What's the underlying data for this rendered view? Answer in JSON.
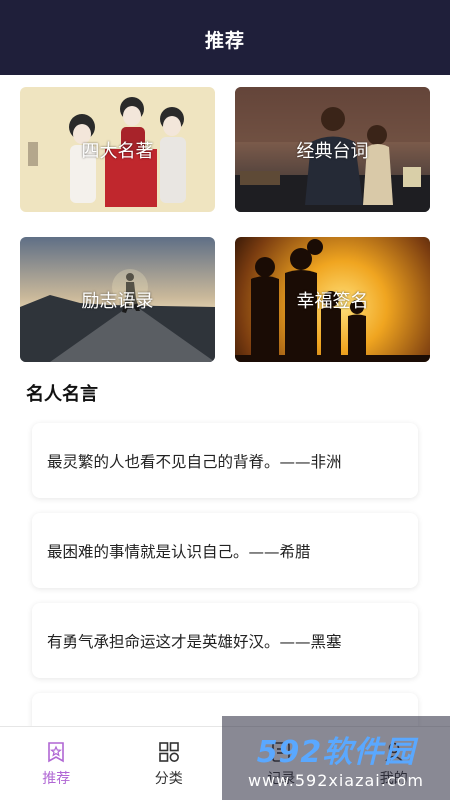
{
  "header": {
    "title": "推荐"
  },
  "categories": [
    {
      "label": "四大名著"
    },
    {
      "label": "经典台词"
    },
    {
      "label": "励志语录"
    },
    {
      "label": "幸福签名"
    }
  ],
  "section": {
    "title": "名人名言"
  },
  "quotes": [
    {
      "text": "最灵繁的人也看不见自己的背脊。——非洲"
    },
    {
      "text": "最困难的事情就是认识自己。——希腊"
    },
    {
      "text": "有勇气承担命运这才是英雄好汉。——黑塞"
    },
    {
      "text": ""
    }
  ],
  "tabs": [
    {
      "label": "推荐",
      "icon": "star-bookmark-icon",
      "active": true
    },
    {
      "label": "分类",
      "icon": "grid-icon",
      "active": false
    },
    {
      "label": "记录",
      "icon": "record-icon",
      "active": false
    },
    {
      "label": "我的",
      "icon": "user-icon",
      "active": false
    }
  ],
  "watermark": {
    "main": "592软件园",
    "sub": "www.592xiazai.com"
  },
  "colors": {
    "header_bg": "#1f1f3a",
    "accent": "#b067d4"
  }
}
